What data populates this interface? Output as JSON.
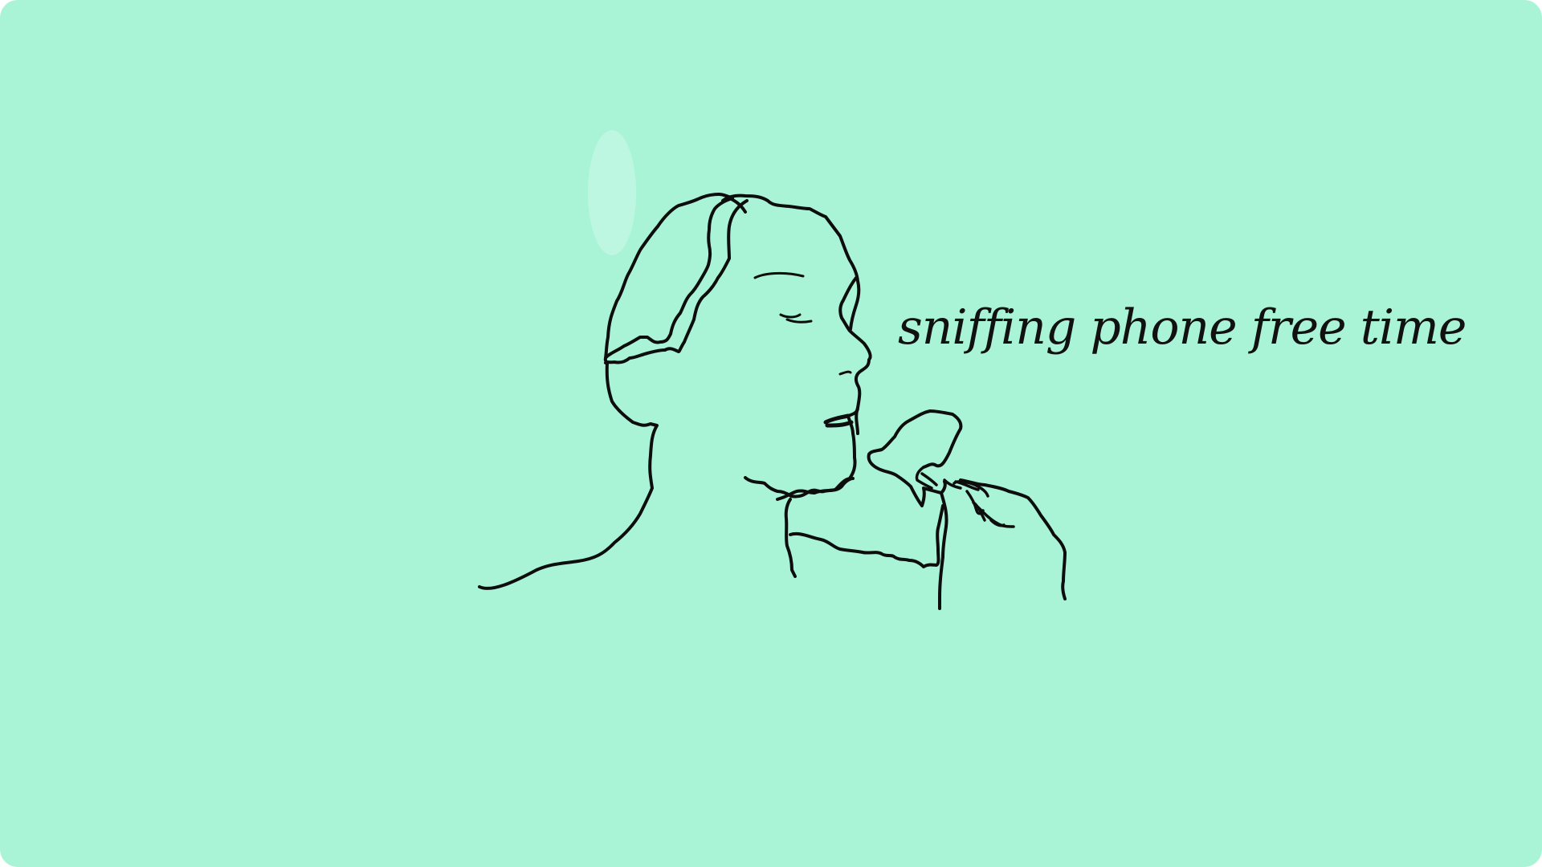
{
  "background_color": "#a9f4d7",
  "ink_color": "#0d0d0d",
  "illustration": {
    "subject": "line-drawing-person-holding-phone",
    "icon": "person-line-art"
  },
  "caption": {
    "text": "sniffing phone free time"
  }
}
